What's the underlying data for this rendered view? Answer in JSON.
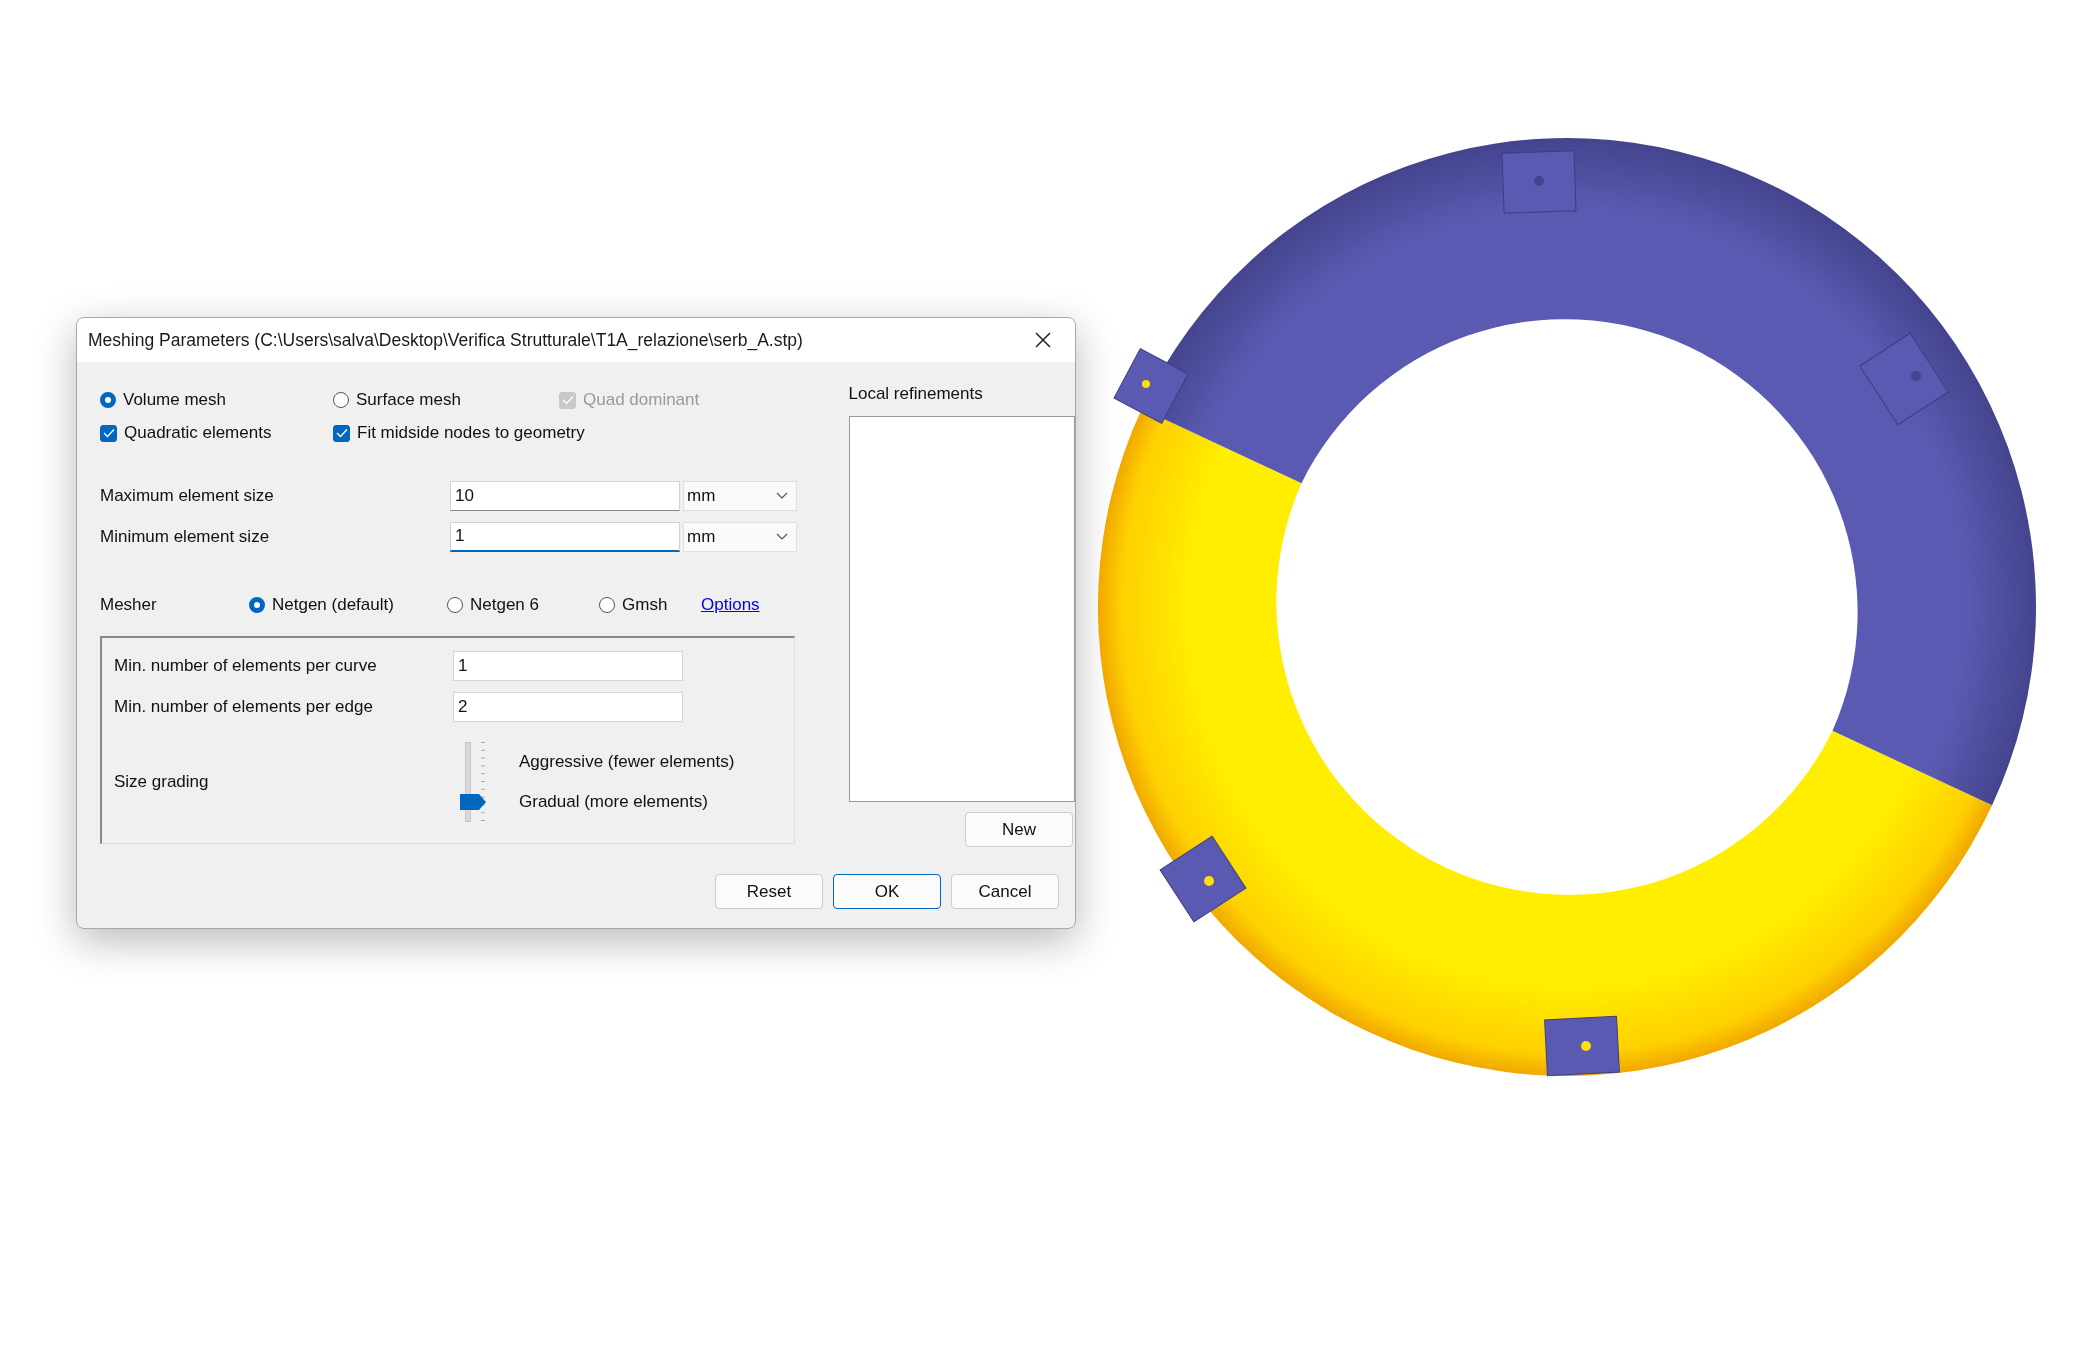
{
  "window": {
    "title": "Meshing Parameters (C:\\Users\\salva\\Desktop\\Verifica Strutturale\\T1A_relazione\\serb_A.stp)"
  },
  "mesh_type": [
    {
      "label": "Volume mesh",
      "selected": true
    },
    {
      "label": "Surface mesh",
      "selected": false
    }
  ],
  "quad_dominant": {
    "label": "Quad dominant",
    "checked": true,
    "disabled": true
  },
  "options": [
    {
      "label": "Quadratic elements",
      "checked": true
    },
    {
      "label": "Fit midside nodes to geometry",
      "checked": true
    }
  ],
  "size_fields": [
    {
      "label": "Maximum element size",
      "value": "10",
      "unit": "mm",
      "focused": false
    },
    {
      "label": "Minimum element size",
      "value": "1",
      "unit": "mm",
      "focused": true
    }
  ],
  "mesher": {
    "label": "Mesher",
    "choices": [
      {
        "label": "Netgen (default)",
        "selected": true
      },
      {
        "label": "Netgen 6",
        "selected": false
      },
      {
        "label": "Gmsh",
        "selected": false
      }
    ],
    "link": "Options"
  },
  "netgen": {
    "fields": [
      {
        "label": "Min. number of elements per curve",
        "value": "1"
      },
      {
        "label": "Min. number of elements per edge",
        "value": "2"
      }
    ],
    "size_grading": {
      "label": "Size grading",
      "level": 0.25,
      "top_label": "Aggressive (fewer elements)",
      "bottom_label": "Gradual (more elements)"
    }
  },
  "local_refinements": {
    "title": "Local refinements",
    "button": "New"
  },
  "buttons": [
    {
      "label": "Reset",
      "default": false
    },
    {
      "label": "OK",
      "default": true
    },
    {
      "label": "Cancel",
      "default": false
    }
  ]
}
